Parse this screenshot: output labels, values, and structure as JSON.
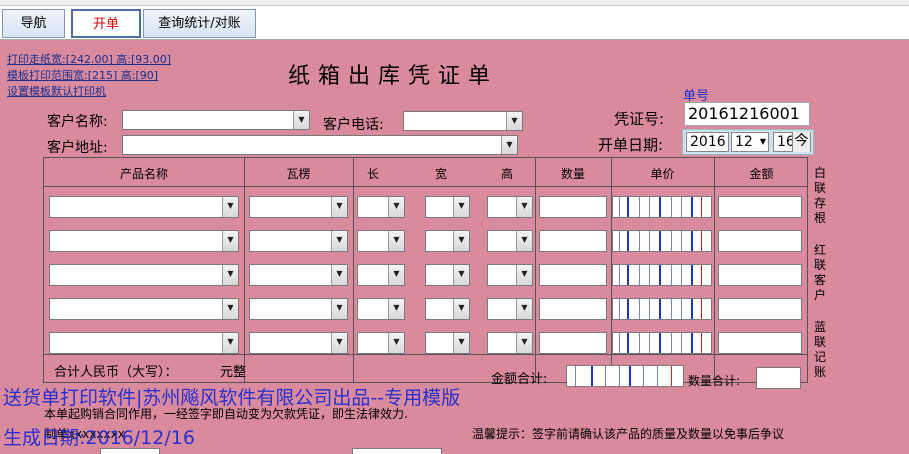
{
  "tabs": [
    {
      "label": "导航"
    },
    {
      "label": "开单"
    },
    {
      "label": "查询统计/对账"
    }
  ],
  "print_links": {
    "paper_size": "打印走纸宽:[242.00] 高:[93.00]",
    "template_range": "模板打印范围宽:[215] 高:[90]",
    "default_printer": "设置模板默认打印机"
  },
  "form": {
    "title": "纸箱出库凭证单",
    "customer_name_label": "客户名称:",
    "customer_phone_label": "客户电话:",
    "customer_address_label": "客户地址:",
    "voucher_caption": "单号",
    "voucher_label": "凭证号:",
    "voucher_no": "20161216001",
    "date_label": "开单日期:",
    "date_year": "2016",
    "date_month": "12",
    "date_day": "16",
    "today_button": "今"
  },
  "table": {
    "headers": [
      "产品名称",
      "瓦楞",
      "长",
      "宽",
      "高",
      "数量",
      "单价",
      "金额"
    ],
    "row_count": 5
  },
  "side_labels": {
    "white": "白联存根",
    "red": "红联客户",
    "blue": "蓝联记账"
  },
  "totals": {
    "rmb_label": "合计人民币（大写）：",
    "rmb_value": "元整",
    "amount_label": "金额合计:",
    "qty_label": "数量合计:"
  },
  "footer": {
    "contract_note": "本单起购销合同作用，一经签字即自动变为欠款凭证，即生法律效力.",
    "hint": "温馨提示：签字前请确认该产品的质量及数量以免事后争议",
    "maker_prefix": "制单",
    "maker_rest": "xxxxxxxx"
  },
  "overlay": {
    "software": "送货单打印软件|苏州飚风软件有限公司出品--专用模版",
    "generated": "生成日期:2016/12/16"
  }
}
